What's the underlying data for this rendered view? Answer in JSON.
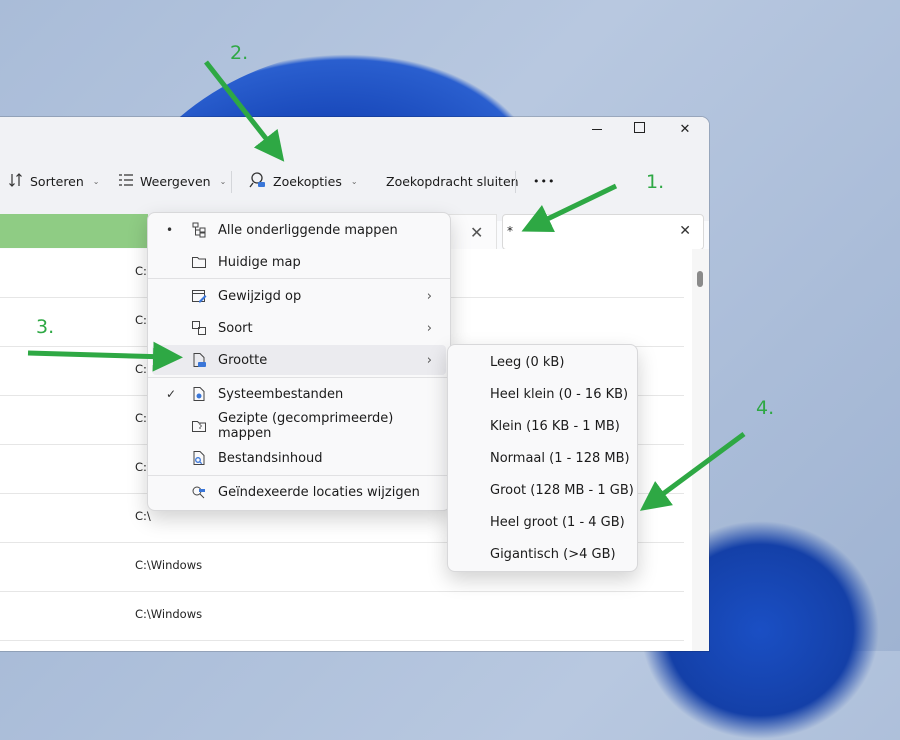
{
  "toolbar": {
    "sort_label": "Sorteren",
    "view_label": "Weergeven",
    "search_options_label": "Zoekopties",
    "close_search_label": "Zoekopdracht sluiten",
    "more_label": "•••"
  },
  "search": {
    "value": "*",
    "clear": "✕"
  },
  "address": {
    "clear": "✕"
  },
  "rows": [
    {
      "path": "C:\\"
    },
    {
      "path": "C:\\"
    },
    {
      "path": "C:\\"
    },
    {
      "path": "C:\\"
    },
    {
      "path": "C:\\"
    },
    {
      "path": "C:\\"
    },
    {
      "path": "C:\\Windows"
    },
    {
      "path": "C:\\Windows"
    }
  ],
  "menu": {
    "items": [
      {
        "label": "Alle onderliggende mappen",
        "mark": "•",
        "icon": "tree-icon"
      },
      {
        "label": "Huidige map",
        "icon": "folder-icon"
      },
      {
        "label": "Gewijzigd op",
        "icon": "calendar-icon",
        "arrow": "›"
      },
      {
        "label": "Soort",
        "icon": "shapes-icon",
        "arrow": "›"
      },
      {
        "label": "Grootte",
        "icon": "file-size-icon",
        "arrow": "›"
      },
      {
        "label": "Systeembestanden",
        "mark": "✓",
        "icon": "system-file-icon"
      },
      {
        "label": "Gezipte (gecomprimeerde) mappen",
        "icon": "zip-folder-icon"
      },
      {
        "label": "Bestandsinhoud",
        "icon": "file-search-icon"
      },
      {
        "label": "Geïndexeerde locaties wijzigen",
        "icon": "index-search-icon"
      }
    ]
  },
  "submenu": {
    "items": [
      "Leeg (0 kB)",
      "Heel klein (0 - 16 KB)",
      "Klein (16 KB - 1 MB)",
      "Normaal (1 - 128 MB)",
      "Groot (128 MB - 1 GB)",
      "Heel groot (1 - 4 GB)",
      "Gigantisch (>4 GB)"
    ]
  },
  "annotations": {
    "a1": "1.",
    "a2": "2.",
    "a3": "3.",
    "a4": "4."
  },
  "colors": {
    "arrow": "#2ea844",
    "breadcrumb": "#8fcc84"
  }
}
